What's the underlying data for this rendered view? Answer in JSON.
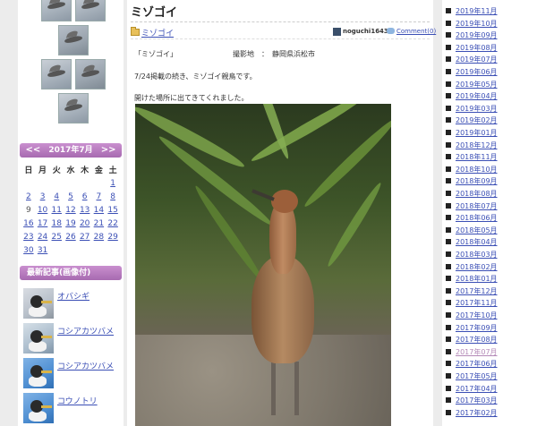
{
  "calendar": {
    "prev": "<<",
    "title": "2017年7月",
    "next": ">>",
    "weekdays": [
      "日",
      "月",
      "火",
      "水",
      "木",
      "金",
      "土"
    ],
    "weeks": [
      [
        "",
        "",
        "",
        "",
        "",
        "",
        "1"
      ],
      [
        "2",
        "3",
        "4",
        "5",
        "6",
        "7",
        "8"
      ],
      [
        "9",
        "10",
        "11",
        "12",
        "13",
        "14",
        "15"
      ],
      [
        "16",
        "17",
        "18",
        "19",
        "20",
        "21",
        "22"
      ],
      [
        "23",
        "24",
        "25",
        "26",
        "27",
        "28",
        "29"
      ],
      [
        "30",
        "31",
        "",
        "",
        "",
        "",
        ""
      ]
    ]
  },
  "recent": {
    "header": "最新記事(画像付)",
    "items": [
      {
        "label": "オバシギ"
      },
      {
        "label": "コシアカツバメ"
      },
      {
        "label": "コシアカツバメ"
      },
      {
        "label": "コウノトリ"
      }
    ]
  },
  "post": {
    "title": "ミゾゴイ",
    "category": "ミゾゴイ",
    "author": "noguchi1643",
    "comment": "Comment(0)",
    "caption": "「ミゾゴイ」",
    "location": "撮影地　：　静岡県浜松市",
    "line1": "7/24掲載の続き、ミゾゴイ親鳥です。",
    "line2": "開けた場所に出てきてくれました。"
  },
  "archive": [
    "2019年11月",
    "2019年10月",
    "2019年09月",
    "2019年08月",
    "2019年07月",
    "2019年06月",
    "2019年05月",
    "2019年04月",
    "2019年03月",
    "2019年02月",
    "2019年01月",
    "2018年12月",
    "2018年11月",
    "2018年10月",
    "2018年09月",
    "2018年08月",
    "2018年07月",
    "2018年06月",
    "2018年05月",
    "2018年04月",
    "2018年03月",
    "2018年02月",
    "2018年01月",
    "2017年12月",
    "2017年11月",
    "2017年10月",
    "2017年09月",
    "2017年08月",
    "2017年07月",
    "2017年06月",
    "2017年05月",
    "2017年04月",
    "2017年03月",
    "2017年02月"
  ]
}
